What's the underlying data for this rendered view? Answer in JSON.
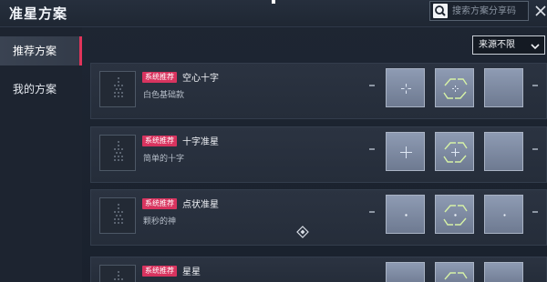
{
  "header": {
    "title": "准星方案",
    "search_placeholder": "搜索方案分享码"
  },
  "sidebar": {
    "items": [
      {
        "label": "推荐方案",
        "active": true
      },
      {
        "label": "我的方案",
        "active": false
      }
    ]
  },
  "filter": {
    "selected": "来源不限"
  },
  "cards": [
    {
      "tag": "系统推荐",
      "title": "空心十字",
      "desc": "白色基础款"
    },
    {
      "tag": "系统推荐",
      "title": "十字准星",
      "desc": "简单的十字"
    },
    {
      "tag": "系统推荐",
      "title": "点状准星",
      "desc": "颗秒的神"
    },
    {
      "tag": "系统推荐",
      "title": "星星",
      "desc": ""
    }
  ],
  "colors": {
    "accent": "#e0345a",
    "tag": "#d8345f",
    "crosshair_light": "#dfe8f5",
    "crosshair_green": "#d6f2a6"
  }
}
